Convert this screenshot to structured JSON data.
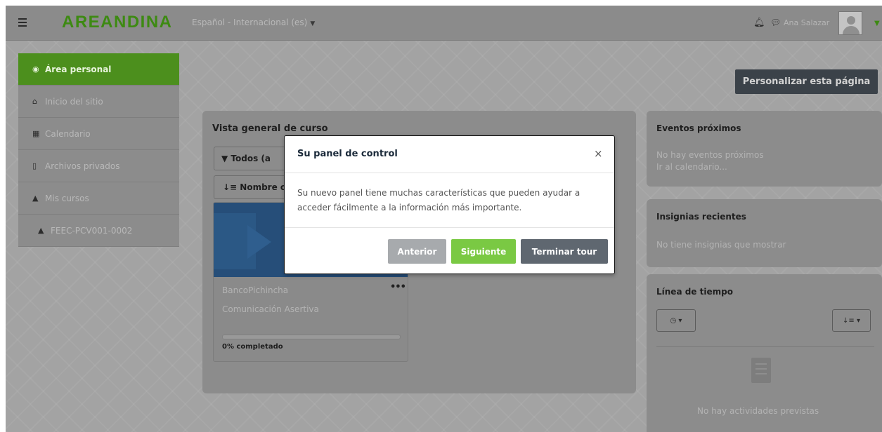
{
  "navbar": {
    "brand": "AREANDINA",
    "language": "Español - Internacional (es)",
    "user_name": "Ana Salazar"
  },
  "left_nav": {
    "items": [
      {
        "label": "Área personal",
        "icon": "dashboard-icon"
      },
      {
        "label": "Inicio del sitio",
        "icon": "home-icon"
      },
      {
        "label": "Calendario",
        "icon": "calendar-icon"
      },
      {
        "label": "Archivos privados",
        "icon": "file-icon"
      },
      {
        "label": "Mis cursos",
        "icon": "graduation-cap-icon"
      },
      {
        "label": "FEEC-PCV001-0002",
        "icon": "graduation-cap-icon"
      }
    ]
  },
  "customize_button": "Personalizar esta página",
  "course_overview": {
    "title": "Vista general de curso",
    "filter_label": "Todos (a",
    "sort_label": "Nombre c",
    "course": {
      "category": "BancoPichincha",
      "name": "Comunicación Asertiva",
      "progress_percent": 0,
      "progress_label": "0% completado"
    }
  },
  "upcoming_events": {
    "title": "Eventos próximos",
    "empty_text": "No hay eventos próximos",
    "link": "Ir al calendario..."
  },
  "recent_badges": {
    "title": "Insignias recientes",
    "empty_text": "No tiene insignias que mostrar"
  },
  "timeline": {
    "title": "Línea de tiempo",
    "empty_text": "No hay actividades previstas"
  },
  "tour_modal": {
    "title": "Su panel de control",
    "close": "×",
    "body": "Su nuevo panel tiene muchas características que pueden ayudar a acceder fácilmente a la información más importante.",
    "prev": "Anterior",
    "next": "Siguiente",
    "end": "Terminar tour"
  },
  "colors": {
    "brand_green": "#7ac943",
    "active_nav": "#4c8f1d",
    "course_image": "#264e79",
    "dark_button": "#3b4249"
  }
}
